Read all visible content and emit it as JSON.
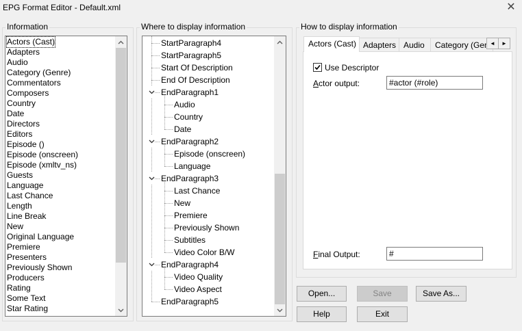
{
  "window": {
    "title": "EPG Format Editor - Default.xml",
    "close_glyph": "✕"
  },
  "information": {
    "label": "Information",
    "items": [
      "Actors (Cast)",
      "Adapters",
      "Audio",
      "Category (Genre)",
      "Commentators",
      "Composers",
      "Country",
      "Date",
      "Directors",
      "Editors",
      "Episode ()",
      "Episode (onscreen)",
      "Episode (xmltv_ns)",
      "Guests",
      "Language",
      "Last Chance",
      "Length",
      "Line Break",
      "New",
      "Original Language",
      "Premiere",
      "Presenters",
      "Previously Shown",
      "Producers",
      "Rating",
      "Some Text",
      "Star Rating"
    ]
  },
  "where": {
    "label": "Where to display information",
    "items": [
      {
        "label": "StartParagraph4",
        "level": 0,
        "expandable": false
      },
      {
        "label": "StartParagraph5",
        "level": 0,
        "expandable": false
      },
      {
        "label": "Start Of Description",
        "level": 0,
        "expandable": false
      },
      {
        "label": "End Of Description",
        "level": 0,
        "expandable": false
      },
      {
        "label": "EndParagraph1",
        "level": 0,
        "expandable": true
      },
      {
        "label": "Audio",
        "level": 1,
        "expandable": false
      },
      {
        "label": "Country",
        "level": 1,
        "expandable": false
      },
      {
        "label": "Date",
        "level": 1,
        "expandable": false
      },
      {
        "label": "EndParagraph2",
        "level": 0,
        "expandable": true
      },
      {
        "label": "Episode (onscreen)",
        "level": 1,
        "expandable": false
      },
      {
        "label": "Language",
        "level": 1,
        "expandable": false
      },
      {
        "label": "EndParagraph3",
        "level": 0,
        "expandable": true
      },
      {
        "label": "Last Chance",
        "level": 1,
        "expandable": false
      },
      {
        "label": "New",
        "level": 1,
        "expandable": false
      },
      {
        "label": "Premiere",
        "level": 1,
        "expandable": false
      },
      {
        "label": "Previously Shown",
        "level": 1,
        "expandable": false
      },
      {
        "label": "Subtitles",
        "level": 1,
        "expandable": false
      },
      {
        "label": "Video Color B/W",
        "level": 1,
        "expandable": false
      },
      {
        "label": "EndParagraph4",
        "level": 0,
        "expandable": true
      },
      {
        "label": "Video Quality",
        "level": 1,
        "expandable": false
      },
      {
        "label": "Video Aspect",
        "level": 1,
        "expandable": false
      },
      {
        "label": "EndParagraph5",
        "level": 0,
        "expandable": false
      }
    ]
  },
  "how": {
    "label": "How to display information",
    "tabs": [
      "Actors (Cast)",
      "Adapters",
      "Audio",
      "Category (Genre)"
    ],
    "active_tab": 0,
    "tab_scroll_left": "◄",
    "tab_scroll_right": "►",
    "use_descriptor": {
      "label": "Use Descriptor",
      "checked": true
    },
    "actor_output": {
      "label_pre": "",
      "label_accel": "A",
      "label_post": "ctor output:",
      "value": "#actor (#role)"
    },
    "final_output": {
      "label_pre": "",
      "label_accel": "F",
      "label_post": "inal Output:",
      "value": "#"
    }
  },
  "buttons": {
    "open": "Open...",
    "save": "Save",
    "save_as": "Save As...",
    "help": "Help",
    "exit": "Exit"
  },
  "icons": {
    "scroll_up": "chevron-up-icon",
    "scroll_down": "chevron-down-icon",
    "expand": "chevron-down-icon"
  }
}
